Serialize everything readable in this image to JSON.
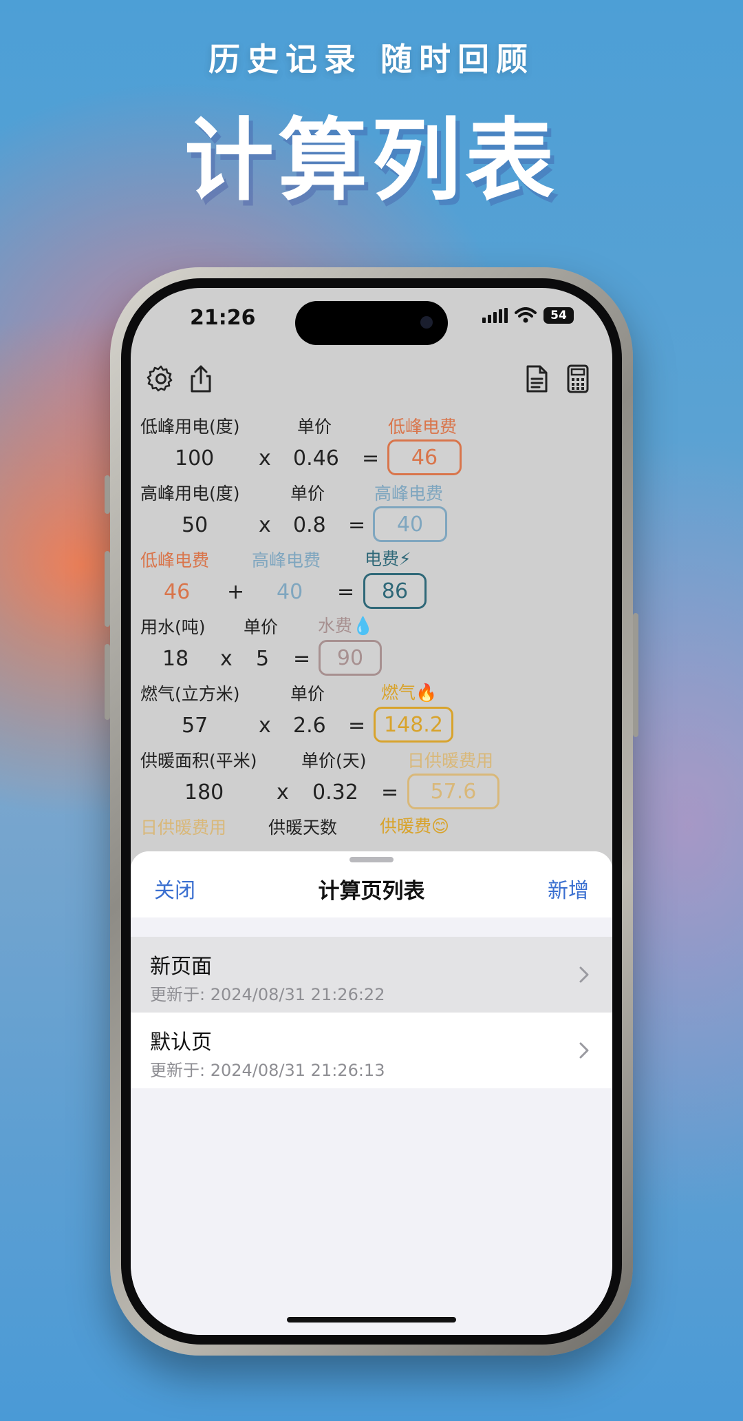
{
  "hero": {
    "subtitle": "历史记录 随时回顾",
    "title": "计算列表"
  },
  "status": {
    "time": "21:26",
    "battery": "54"
  },
  "toolbar": {
    "left_icons": [
      "gear-icon",
      "share-icon"
    ],
    "right_icons": [
      "document-icon",
      "calculator-icon"
    ]
  },
  "calc": {
    "r1": {
      "l1": "低峰用电(度)",
      "l2": "单价",
      "l3": "低峰电费",
      "v1": "100",
      "op": "x",
      "v2": "0.46",
      "eq": "=",
      "res": "46"
    },
    "r2": {
      "l1": "高峰用电(度)",
      "l2": "单价",
      "l3": "高峰电费",
      "v1": "50",
      "op": "x",
      "v2": "0.8",
      "eq": "=",
      "res": "40"
    },
    "r3": {
      "l1": "低峰电费",
      "l2": "高峰电费",
      "l3": "电费⚡",
      "v1": "46",
      "op": "+",
      "v2": "40",
      "eq": "=",
      "res": "86"
    },
    "r4": {
      "l1": "用水(吨)",
      "l2": "单价",
      "l3": "水费💧",
      "v1": "18",
      "op": "x",
      "v2": "5",
      "eq": "=",
      "res": "90"
    },
    "r5": {
      "l1": "燃气(立方米)",
      "l2": "单价",
      "l3": "燃气🔥",
      "v1": "57",
      "op": "x",
      "v2": "2.6",
      "eq": "=",
      "res": "148.2"
    },
    "r6": {
      "l1": "供暖面积(平米)",
      "l2": "单价(天)",
      "l3": "日供暖费用",
      "v1": "180",
      "op": "x",
      "v2": "0.32",
      "eq": "=",
      "res": "57.6"
    },
    "r7": {
      "l1": "日供暖费用",
      "l2": "供暖天数",
      "l3": "供暖费😊"
    }
  },
  "sheet": {
    "close": "关闭",
    "title": "计算页列表",
    "add": "新增",
    "items": [
      {
        "title": "新页面",
        "subtitle": "更新于: 2024/08/31 21:26:22"
      },
      {
        "title": "默认页",
        "subtitle": "更新于: 2024/08/31 21:26:13"
      }
    ]
  },
  "colors": {
    "link": "#3a6fd0",
    "orange": "#d9754b",
    "blue": "#7fa6bf",
    "teal": "#2f6878",
    "gold": "#d8a32c"
  }
}
